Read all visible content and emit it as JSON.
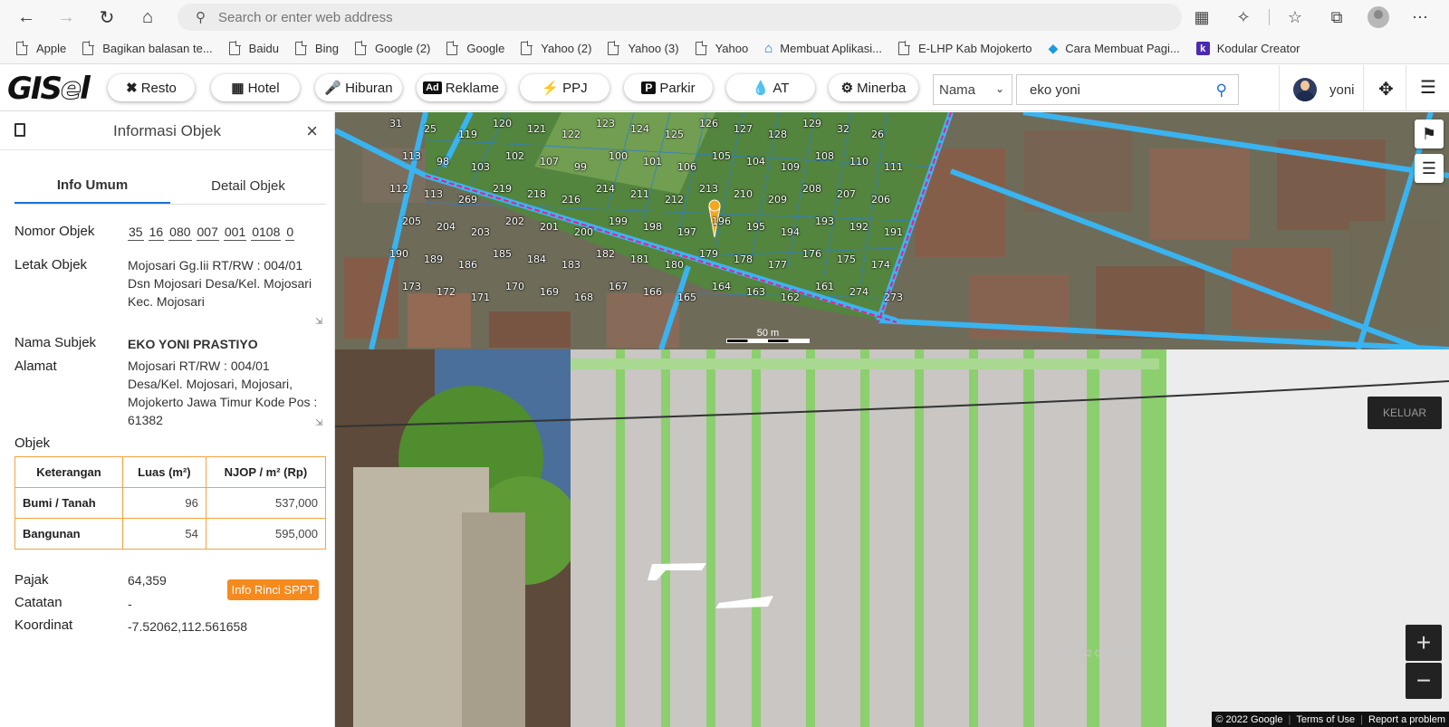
{
  "browser": {
    "address_placeholder": "Search or enter web address",
    "bookmarks": [
      {
        "label": "Apple",
        "icon": "page-icon"
      },
      {
        "label": "Bagikan balasan te...",
        "icon": "page-icon"
      },
      {
        "label": "Baidu",
        "icon": "page-icon"
      },
      {
        "label": "Bing",
        "icon": "page-icon"
      },
      {
        "label": "Google (2)",
        "icon": "page-icon"
      },
      {
        "label": "Google",
        "icon": "page-icon"
      },
      {
        "label": "Yahoo (2)",
        "icon": "page-icon"
      },
      {
        "label": "Yahoo (3)",
        "icon": "page-icon"
      },
      {
        "label": "Yahoo",
        "icon": "page-icon"
      },
      {
        "label": "Membuat Aplikasi...",
        "icon": "house-icon"
      },
      {
        "label": "E-LHP Kab Mojokerto",
        "icon": "page-icon"
      },
      {
        "label": "Cara Membuat Pagi...",
        "icon": "diamond-icon"
      },
      {
        "label": "Kodular Creator",
        "icon": "k-logo-icon"
      }
    ]
  },
  "app": {
    "logo": "GISel",
    "categories": [
      {
        "label": "Resto",
        "icon": "cutlery-icon"
      },
      {
        "label": "Hotel",
        "icon": "building-icon"
      },
      {
        "label": "Hiburan",
        "icon": "microphone-icon"
      },
      {
        "label": "Reklame",
        "icon": "ad-icon"
      },
      {
        "label": "PPJ",
        "icon": "bolt-icon"
      },
      {
        "label": "Parkir",
        "icon": "parking-icon"
      },
      {
        "label": "AT",
        "icon": "water-drop-icon"
      },
      {
        "label": "Minerba",
        "icon": "tractor-icon"
      }
    ],
    "search_type": "Nama",
    "search_value": "eko yoni",
    "user_name": "yoni"
  },
  "panel": {
    "title": "Informasi Objek",
    "tabs": [
      "Info Umum",
      "Detail Objek"
    ],
    "labels": {
      "nomor_objek": "Nomor Objek",
      "letak_objek": "Letak Objek",
      "nama_subjek": "Nama Subjek",
      "alamat": "Alamat",
      "objek": "Objek",
      "pajak": "Pajak",
      "catatan": "Catatan",
      "koordinat": "Koordinat"
    },
    "nomor_objek": [
      "35",
      "16",
      "080",
      "007",
      "001",
      "0108",
      "0"
    ],
    "letak_objek": [
      "Mojosari Gg.Iii RT/RW : 004/01",
      "Dsn Mojosari Desa/Kel. Mojosari",
      "Kec. Mojosari"
    ],
    "nama_subjek": "EKO YONI PRASTIYO",
    "alamat": [
      "Mojosari RT/RW : 004/01",
      "Desa/Kel. Mojosari, Mojosari,",
      "Mojokerto Jawa Timur Kode Pos :",
      "61382"
    ],
    "table": {
      "headers": [
        "Keterangan",
        "Luas (m²)",
        "NJOP / m² (Rp)"
      ],
      "rows": [
        [
          "Bumi / Tanah",
          "96",
          "537,000"
        ],
        [
          "Bangunan",
          "54",
          "595,000"
        ]
      ]
    },
    "pajak": "64,359",
    "info_button": "Info Rinci SPPT",
    "catatan": "-",
    "koordinat": "-7.52062,112.561658"
  },
  "map": {
    "scale_label": "50 m",
    "parcel_labels": [
      "31",
      "25",
      "119",
      "120",
      "121",
      "122",
      "123",
      "124",
      "125",
      "126",
      "127",
      "128",
      "129",
      "32",
      "26",
      "113",
      "98",
      "103",
      "102",
      "107",
      "99",
      "100",
      "101",
      "106",
      "105",
      "104",
      "109",
      "108",
      "110",
      "111",
      "112",
      "113",
      "269",
      "219",
      "218",
      "216",
      "214",
      "211",
      "212",
      "213",
      "210",
      "209",
      "208",
      "207",
      "206",
      "205",
      "204",
      "203",
      "202",
      "201",
      "200",
      "199",
      "198",
      "197",
      "196",
      "195",
      "194",
      "193",
      "192",
      "191",
      "190",
      "189",
      "186",
      "185",
      "184",
      "183",
      "182",
      "181",
      "180",
      "179",
      "178",
      "177",
      "176",
      "175",
      "174",
      "173",
      "172",
      "171",
      "170",
      "169",
      "168",
      "167",
      "166",
      "165",
      "164",
      "163",
      "162",
      "161",
      "274",
      "273"
    ]
  },
  "streetview": {
    "exit_label": "KELUAR",
    "attribution": [
      "© 2022 Google",
      "Terms of Use",
      "Report a problem"
    ],
    "watermark": "© 2022 Google"
  }
}
